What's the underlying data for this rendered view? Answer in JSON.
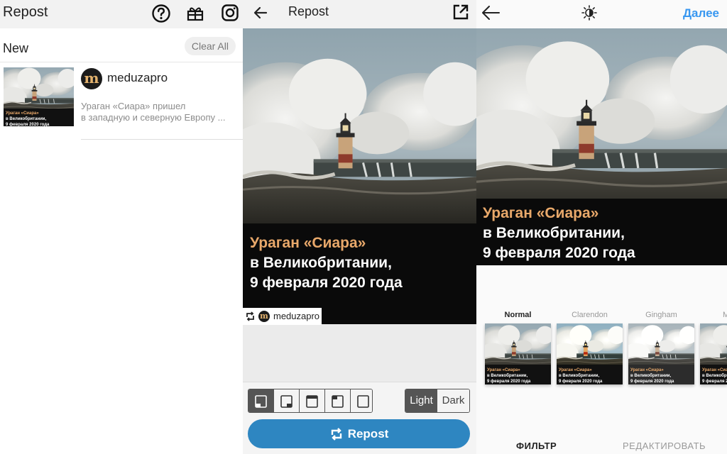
{
  "left_panel": {
    "title": "Repost",
    "icons": [
      "help-icon",
      "gift-icon",
      "instagram-icon"
    ],
    "section_title": "New",
    "clear_all": "Clear All",
    "item": {
      "username": "meduzapro",
      "avatar_letter": "m",
      "caption_line1": "Ураган «Сиара» пришел",
      "caption_line2": "в западную и северную Европу ..."
    }
  },
  "middle_panel": {
    "title": "Repost",
    "post": {
      "headline_line1": "Ураган «Сиара»",
      "headline_line2": "в Великобритании,",
      "headline_line3": "9 февраля 2020 года"
    },
    "watermark_user": "meduzapro",
    "watermark_avatar_letter": "m",
    "position_options": [
      "bottom-left",
      "bottom-right",
      "top-left",
      "top-right",
      "none"
    ],
    "position_selected": "bottom-left",
    "theme_options": [
      "Light",
      "Dark"
    ],
    "theme_light": "Light",
    "theme_dark": "Dark",
    "theme_selected": "Light",
    "repost_button": "Repost",
    "accent_color": "#2e86c1"
  },
  "right_panel": {
    "next": "Далее",
    "post": {
      "headline_line1": "Ураган «Сиара»",
      "headline_line2": "в Великобритании,",
      "headline_line3": "9 февраля 2020 года"
    },
    "filters": [
      {
        "name": "Normal",
        "selected": true
      },
      {
        "name": "Clarendon",
        "selected": false
      },
      {
        "name": "Gingham",
        "selected": false
      },
      {
        "name": "M",
        "selected": false
      }
    ],
    "tab_filter": "ФИЛЬТР",
    "tab_edit": "РЕДАКТИРОВАТЬ",
    "active_tab": "ФИЛЬТР",
    "accent_color": "#3897f0"
  },
  "caption_colors": {
    "highlight": "#e8a86a",
    "text": "#ffffff"
  }
}
